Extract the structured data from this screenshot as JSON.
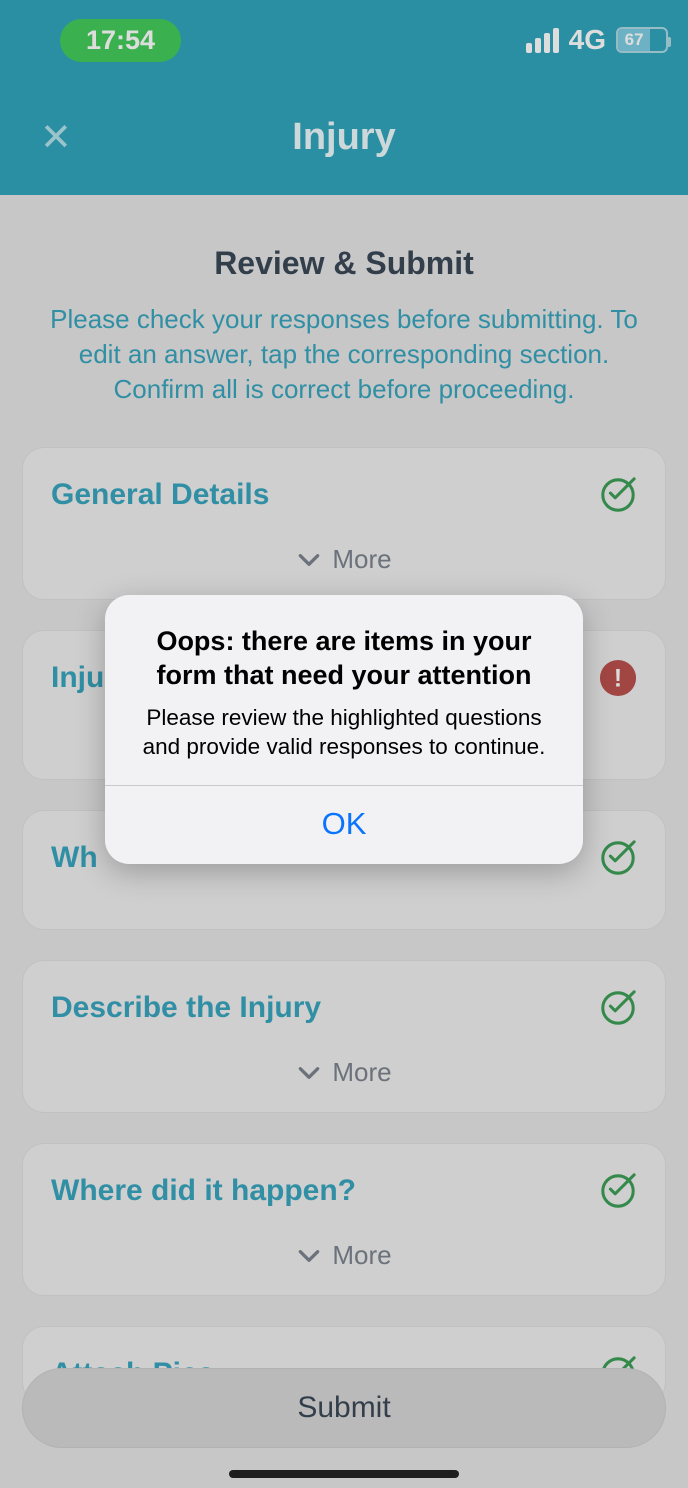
{
  "status": {
    "time": "17:54",
    "network": "4G",
    "battery_pct": "67"
  },
  "nav": {
    "title": "Injury"
  },
  "page": {
    "title": "Review & Submit",
    "subtitle": "Please check your responses before submitting. To edit an answer, tap the corresponding section. Confirm all is correct before proceeding."
  },
  "cards": [
    {
      "title": "General Details",
      "status": "ok",
      "more": "More"
    },
    {
      "title": "Inju",
      "status": "err",
      "more": ""
    },
    {
      "title": "Wh",
      "status": "ok",
      "more": ""
    },
    {
      "title": "Describe the Injury",
      "status": "ok",
      "more": "More"
    },
    {
      "title": "Where did it happen?",
      "status": "ok",
      "more": "More"
    },
    {
      "title": "Attach Pics",
      "status": "ok",
      "more": ""
    }
  ],
  "submit": {
    "label": "Submit"
  },
  "alert": {
    "title": "Oops: there are items in your form that need your attention",
    "message": "Please review the highlighted questions and provide valid responses to continue.",
    "ok": "OK"
  }
}
